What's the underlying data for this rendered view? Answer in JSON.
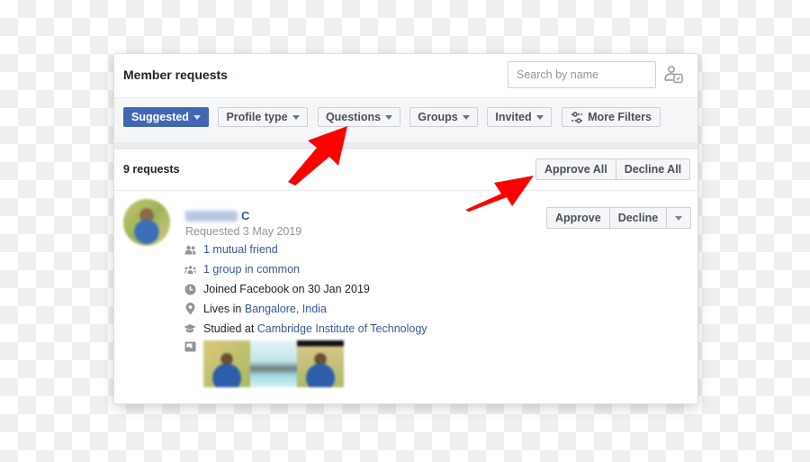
{
  "header": {
    "title": "Member requests",
    "search_placeholder": "Search by name",
    "admin_icon": "member-settings-icon"
  },
  "filters": [
    {
      "label": "Suggested",
      "selected": true
    },
    {
      "label": "Profile type",
      "selected": false
    },
    {
      "label": "Questions",
      "selected": false
    },
    {
      "label": "Groups",
      "selected": false
    },
    {
      "label": "Invited",
      "selected": false
    },
    {
      "label": "More Filters",
      "icon": "sliders-icon",
      "selected": false
    }
  ],
  "requests": {
    "count_label": "9 requests",
    "approve_all_label": "Approve All",
    "decline_all_label": "Decline All"
  },
  "member": {
    "name_visible": "C",
    "name_redacted": true,
    "requested": "Requested 3 May 2019",
    "approve_label": "Approve",
    "decline_label": "Decline",
    "mutual_friends": "1 mutual friend",
    "groups_in_common": "1 group in common",
    "joined": "Joined Facebook on 30 Jan 2019",
    "lives_prefix": "Lives in ",
    "lives_place": "Bangalore, India",
    "studied_prefix": "Studied at ",
    "studied_place": "Cambridge Institute of Technology",
    "photo_count": 3
  },
  "annotations": {
    "arrow_color": "#ff0000",
    "arrows": [
      "points-to-questions-filter",
      "points-to-approve-all"
    ]
  },
  "colors": {
    "accent": "#4267b2",
    "link": "#365899",
    "text": "#1d2129",
    "muted": "#90949c"
  }
}
